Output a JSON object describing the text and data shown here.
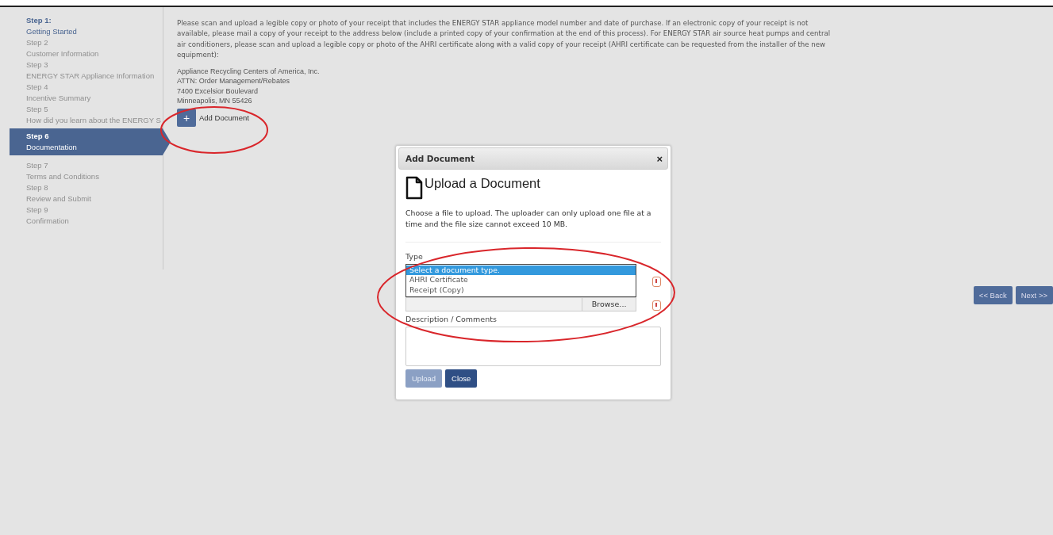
{
  "steps": [
    {
      "number": "Step 1:",
      "title": "Getting Started",
      "selected": false,
      "enabled": true
    },
    {
      "number": "Step 2",
      "title": "Customer Information",
      "selected": false,
      "enabled": false
    },
    {
      "number": "Step 3",
      "title": "ENERGY STAR Appliance Information",
      "selected": false,
      "enabled": false
    },
    {
      "number": "Step 4",
      "title": "Incentive Summary",
      "selected": false,
      "enabled": false
    },
    {
      "number": "Step 5",
      "title": "How did you learn about the ENERGY S",
      "selected": false,
      "enabled": false
    },
    {
      "number": "Step 6",
      "title": "Documentation",
      "selected": true,
      "enabled": true
    },
    {
      "number": "Step 7",
      "title": "Terms and Conditions",
      "selected": false,
      "enabled": false
    },
    {
      "number": "Step 8",
      "title": "Review and Submit",
      "selected": false,
      "enabled": false
    },
    {
      "number": "Step 9",
      "title": "Confirmation",
      "selected": false,
      "enabled": false
    }
  ],
  "instructions": "Please scan and upload a legible copy or photo of your receipt that includes the ENERGY STAR appliance model number and date of purchase.  If an electronic copy of your receipt is not available, please mail a copy of your receipt to the address below (include a printed copy of your confirmation at the end of this process).  For ENERGY STAR air source heat pumps and central air conditioners, please scan and upload a legible copy or photo of the AHRI certificate along with a valid copy of your receipt (AHRI certificate can be requested from the installer of the new equipment):",
  "address": [
    "Appliance Recycling Centers of America, Inc.",
    "ATTN: Order Management/Rebates",
    "7400 Excelsior Boulevard",
    "Minneapolis, MN 55426"
  ],
  "add_button": {
    "icon": "+",
    "label": "Add Document"
  },
  "dialog": {
    "title": "Add Document",
    "close": "×",
    "heading": "Upload a Document",
    "description": "Choose a file to upload. The uploader can only upload one file at a time and the file size cannot exceed 10 MB.",
    "type_label": "Type",
    "type_options": [
      {
        "label": "Select a document type.",
        "selected": true
      },
      {
        "label": "AHRI Certificate",
        "selected": false
      },
      {
        "label": "Receipt (Copy)",
        "selected": false
      }
    ],
    "browse": "Browse...",
    "comments_label": "Description / Comments",
    "buttons": [
      {
        "label": "Upload",
        "disabled": true
      },
      {
        "label": "Close",
        "disabled": false
      }
    ]
  },
  "nav": [
    {
      "label": "<< Back"
    },
    {
      "label": "Next >>"
    }
  ]
}
